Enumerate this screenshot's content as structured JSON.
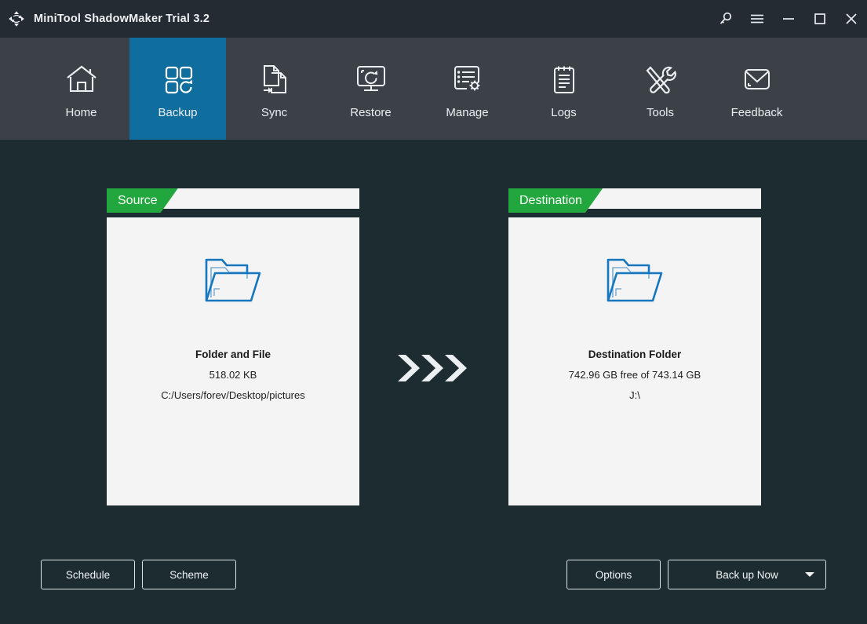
{
  "window": {
    "title": "MiniTool ShadowMaker Trial 3.2",
    "logo_icon": "move-arrows-logo-icon",
    "controls": [
      {
        "name": "search-key-icon",
        "label": "Search"
      },
      {
        "name": "hamburger-menu-icon",
        "label": "Menu"
      },
      {
        "name": "minimize-icon",
        "label": "Minimize"
      },
      {
        "name": "maximize-icon",
        "label": "Maximize"
      },
      {
        "name": "close-icon",
        "label": "Close"
      }
    ]
  },
  "nav": {
    "active": "Backup",
    "active_color": "#0f6e9e",
    "items": [
      {
        "label": "Home",
        "icon": "home-icon"
      },
      {
        "label": "Backup",
        "icon": "backup-icon"
      },
      {
        "label": "Sync",
        "icon": "sync-icon"
      },
      {
        "label": "Restore",
        "icon": "restore-icon"
      },
      {
        "label": "Manage",
        "icon": "manage-icon"
      },
      {
        "label": "Logs",
        "icon": "logs-icon"
      },
      {
        "label": "Tools",
        "icon": "tools-icon"
      },
      {
        "label": "Feedback",
        "icon": "feedback-icon"
      }
    ]
  },
  "main": {
    "source": {
      "tab_label": "Source",
      "icon": "folder-icon",
      "title": "Folder and File",
      "size": "518.02 KB",
      "path": "C:/Users/forev/Desktop/pictures"
    },
    "destination": {
      "tab_label": "Destination",
      "icon": "folder-icon",
      "title": "Destination Folder",
      "free_space": "742.96 GB free of 743.14 GB",
      "path": "J:\\"
    },
    "arrow_icon": "triple-chevron-right-icon"
  },
  "buttons": {
    "schedule": "Schedule",
    "scheme": "Scheme",
    "options": "Options",
    "backup_now": "Back up Now",
    "backup_caret_icon": "chevron-down-icon"
  },
  "colors": {
    "titlebar": "#252b32",
    "navbar": "#3b4147",
    "background": "#1c2c30",
    "accent_blue": "#0f6e9e",
    "tab_green": "#22a73f",
    "card": "#f4f4f4",
    "folder_blue": "#1577bd"
  }
}
